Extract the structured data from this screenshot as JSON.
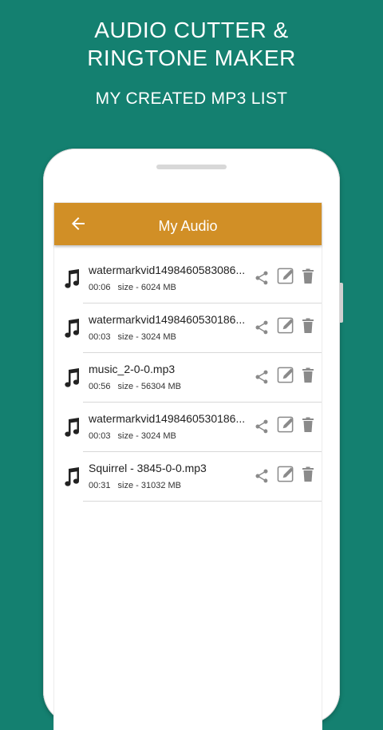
{
  "promo": {
    "title": "AUDIO CUTTER &\nRINGTONE MAKER",
    "subtitle": "MY CREATED MP3 LIST"
  },
  "app_bar": {
    "title": "My Audio",
    "back_icon": "arrow-left-icon"
  },
  "colors": {
    "background": "#148070",
    "app_bar": "#d18f26",
    "icon_gray": "#8a8a8a"
  },
  "files": [
    {
      "name": "watermarkvid1498460583086...",
      "duration": "00:06",
      "size": "size - 6024 MB"
    },
    {
      "name": "watermarkvid1498460530186...",
      "duration": "00:03",
      "size": "size - 3024 MB"
    },
    {
      "name": "music_2-0-0.mp3",
      "duration": "00:56",
      "size": "size - 56304 MB"
    },
    {
      "name": "watermarkvid1498460530186...",
      "duration": "00:03",
      "size": "size - 3024 MB"
    },
    {
      "name": "Squirrel - 3845-0-0.mp3",
      "duration": "00:31",
      "size": "size - 31032 MB"
    }
  ],
  "row_icons": {
    "file": "music-note-icon",
    "share": "share-icon",
    "edit": "edit-icon",
    "delete": "trash-icon"
  }
}
